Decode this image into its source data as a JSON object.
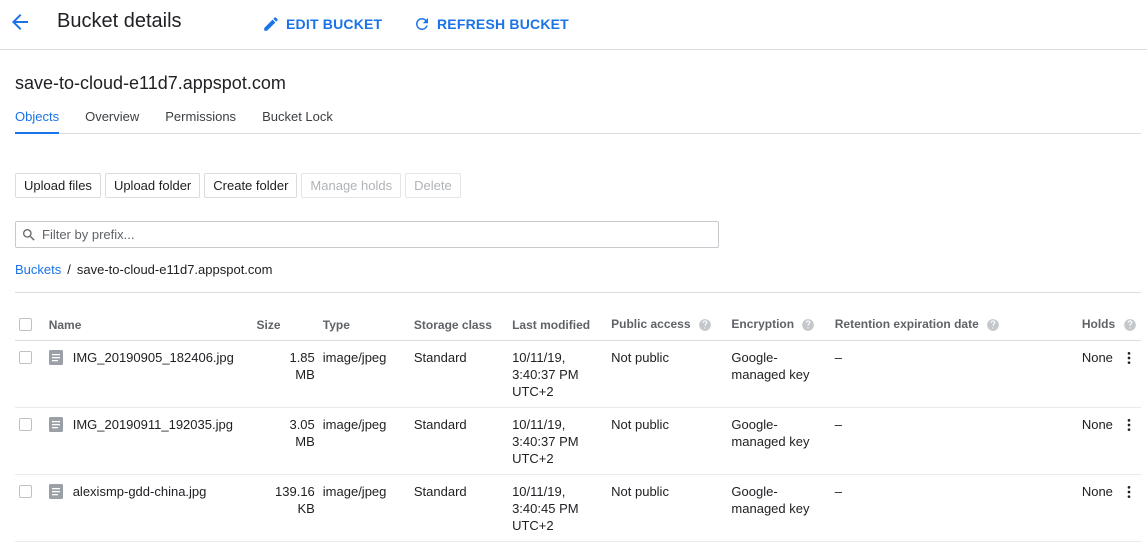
{
  "header": {
    "back_icon": "arrow-back-icon",
    "title": "Bucket details",
    "edit_label": "EDIT BUCKET",
    "refresh_label": "REFRESH BUCKET",
    "accent": "#1a73e8"
  },
  "bucket": {
    "name": "save-to-cloud-e11d7.appspot.com"
  },
  "tabs": [
    {
      "label": "Objects",
      "active": true
    },
    {
      "label": "Overview"
    },
    {
      "label": "Permissions"
    },
    {
      "label": "Bucket Lock"
    }
  ],
  "toolbar": {
    "upload_files": "Upload files",
    "upload_folder": "Upload folder",
    "create_folder": "Create folder",
    "manage_holds": "Manage holds",
    "delete": "Delete"
  },
  "filter": {
    "placeholder": "Filter by prefix..."
  },
  "breadcrumb": {
    "root": "Buckets",
    "separator": "/",
    "current": "save-to-cloud-e11d7.appspot.com"
  },
  "table": {
    "columns": {
      "name": "Name",
      "size": "Size",
      "type": "Type",
      "storage_class": "Storage class",
      "last_modified": "Last modified",
      "public_access": "Public access",
      "encryption": "Encryption",
      "retention": "Retention expiration date",
      "holds": "Holds"
    },
    "rows": [
      {
        "name": "IMG_20190905_182406.jpg",
        "size": [
          "1.85",
          "MB"
        ],
        "type": "image/jpeg",
        "storage_class": "Standard",
        "last_modified": [
          "10/11/19,",
          "3:40:37 PM",
          "UTC+2"
        ],
        "public_access": "Not public",
        "encryption": [
          "Google-",
          "managed key"
        ],
        "retention": "–",
        "holds": "None"
      },
      {
        "name": "IMG_20190911_192035.jpg",
        "size": [
          "3.05",
          "MB"
        ],
        "type": "image/jpeg",
        "storage_class": "Standard",
        "last_modified": [
          "10/11/19,",
          "3:40:37 PM",
          "UTC+2"
        ],
        "public_access": "Not public",
        "encryption": [
          "Google-",
          "managed key"
        ],
        "retention": "–",
        "holds": "None"
      },
      {
        "name": "alexismp-gdd-china.jpg",
        "size": [
          "139.16",
          "KB"
        ],
        "type": "image/jpeg",
        "storage_class": "Standard",
        "last_modified": [
          "10/11/19,",
          "3:40:45 PM",
          "UTC+2"
        ],
        "public_access": "Not public",
        "encryption": [
          "Google-",
          "managed key"
        ],
        "retention": "–",
        "holds": "None"
      }
    ]
  }
}
